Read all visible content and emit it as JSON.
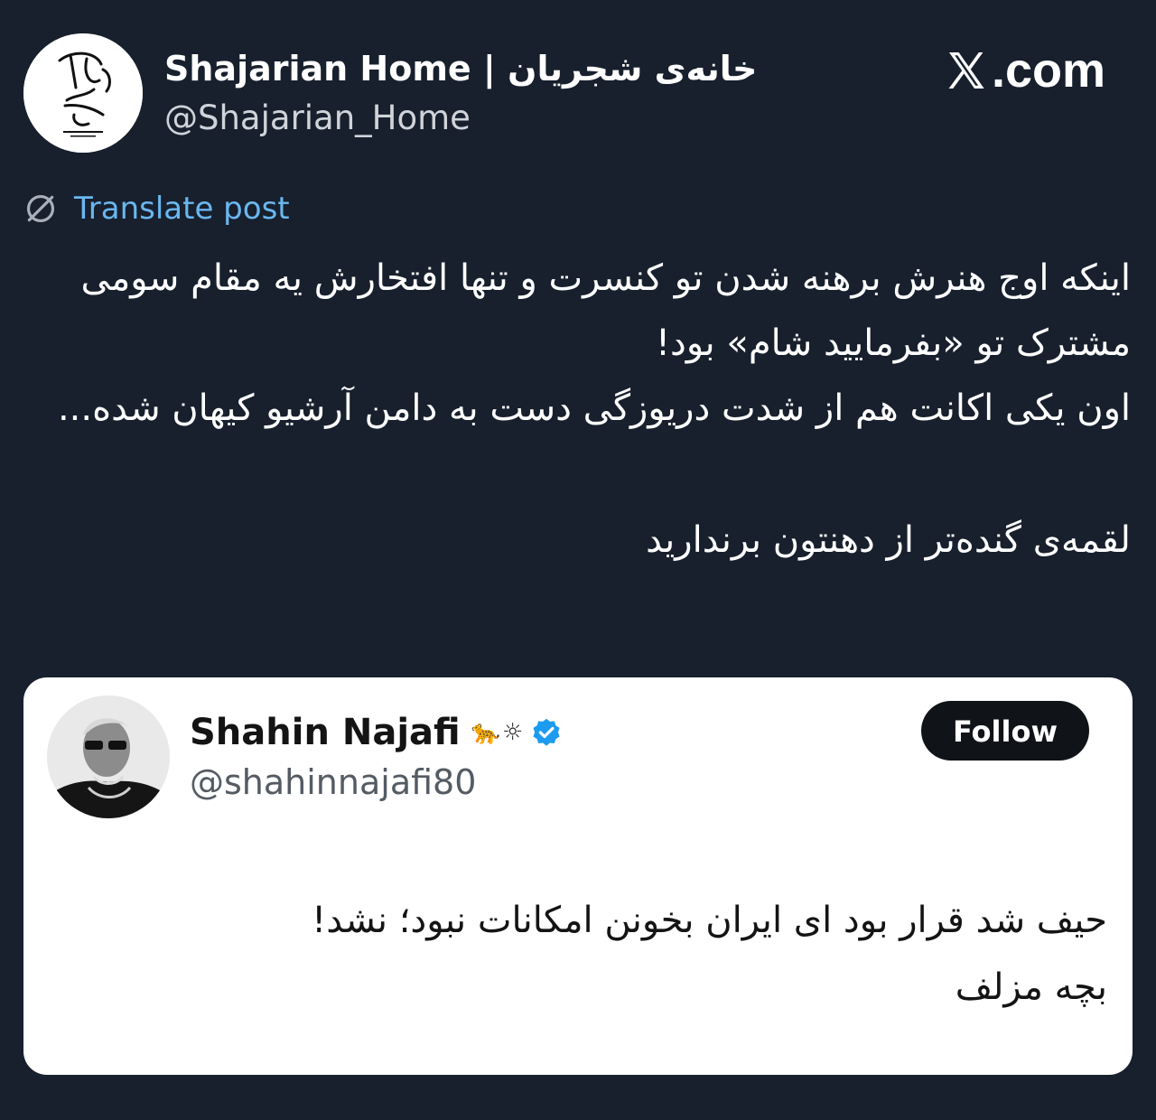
{
  "header": {
    "display_name": "Shajarian Home | خانه‌ی شجریان",
    "handle": "@Shajarian_Home",
    "avatar_icon": "shajarian-home-logo",
    "site_label": ".com",
    "site_icon": "x-logo-icon"
  },
  "translate": {
    "label": "Translate post",
    "icon": "globe-icon"
  },
  "post": {
    "paragraph_1": "اینکه اوج هنرش برهنه شدن تو کنسرت و تنها افتخارش یه مقام سومی مشترک تو «بفرمایید شام» بود!",
    "paragraph_2": "اون یکی اکانت هم از شدت دریوزگی دست به دامن آرشیو کیهان شده...",
    "paragraph_3": "لقمه‌ی گنده‌تر از دهنتون برندارید"
  },
  "quoted": {
    "name": "Shahin Najafi",
    "name_emojis": "🐆☼",
    "verified_icon": "verified-badge-icon",
    "verified_color": "#1d9bf0",
    "handle": "@shahinnajafi80",
    "follow_label": "Follow",
    "line_1": "حیف شد قرار بود ای ایران بخونن امکانات نبود؛ نشد!",
    "line_2": "بچه مزلف"
  },
  "colors": {
    "background": "#18202d",
    "link": "#6ab7f0",
    "card": "#ffffff",
    "button": "#101318"
  }
}
